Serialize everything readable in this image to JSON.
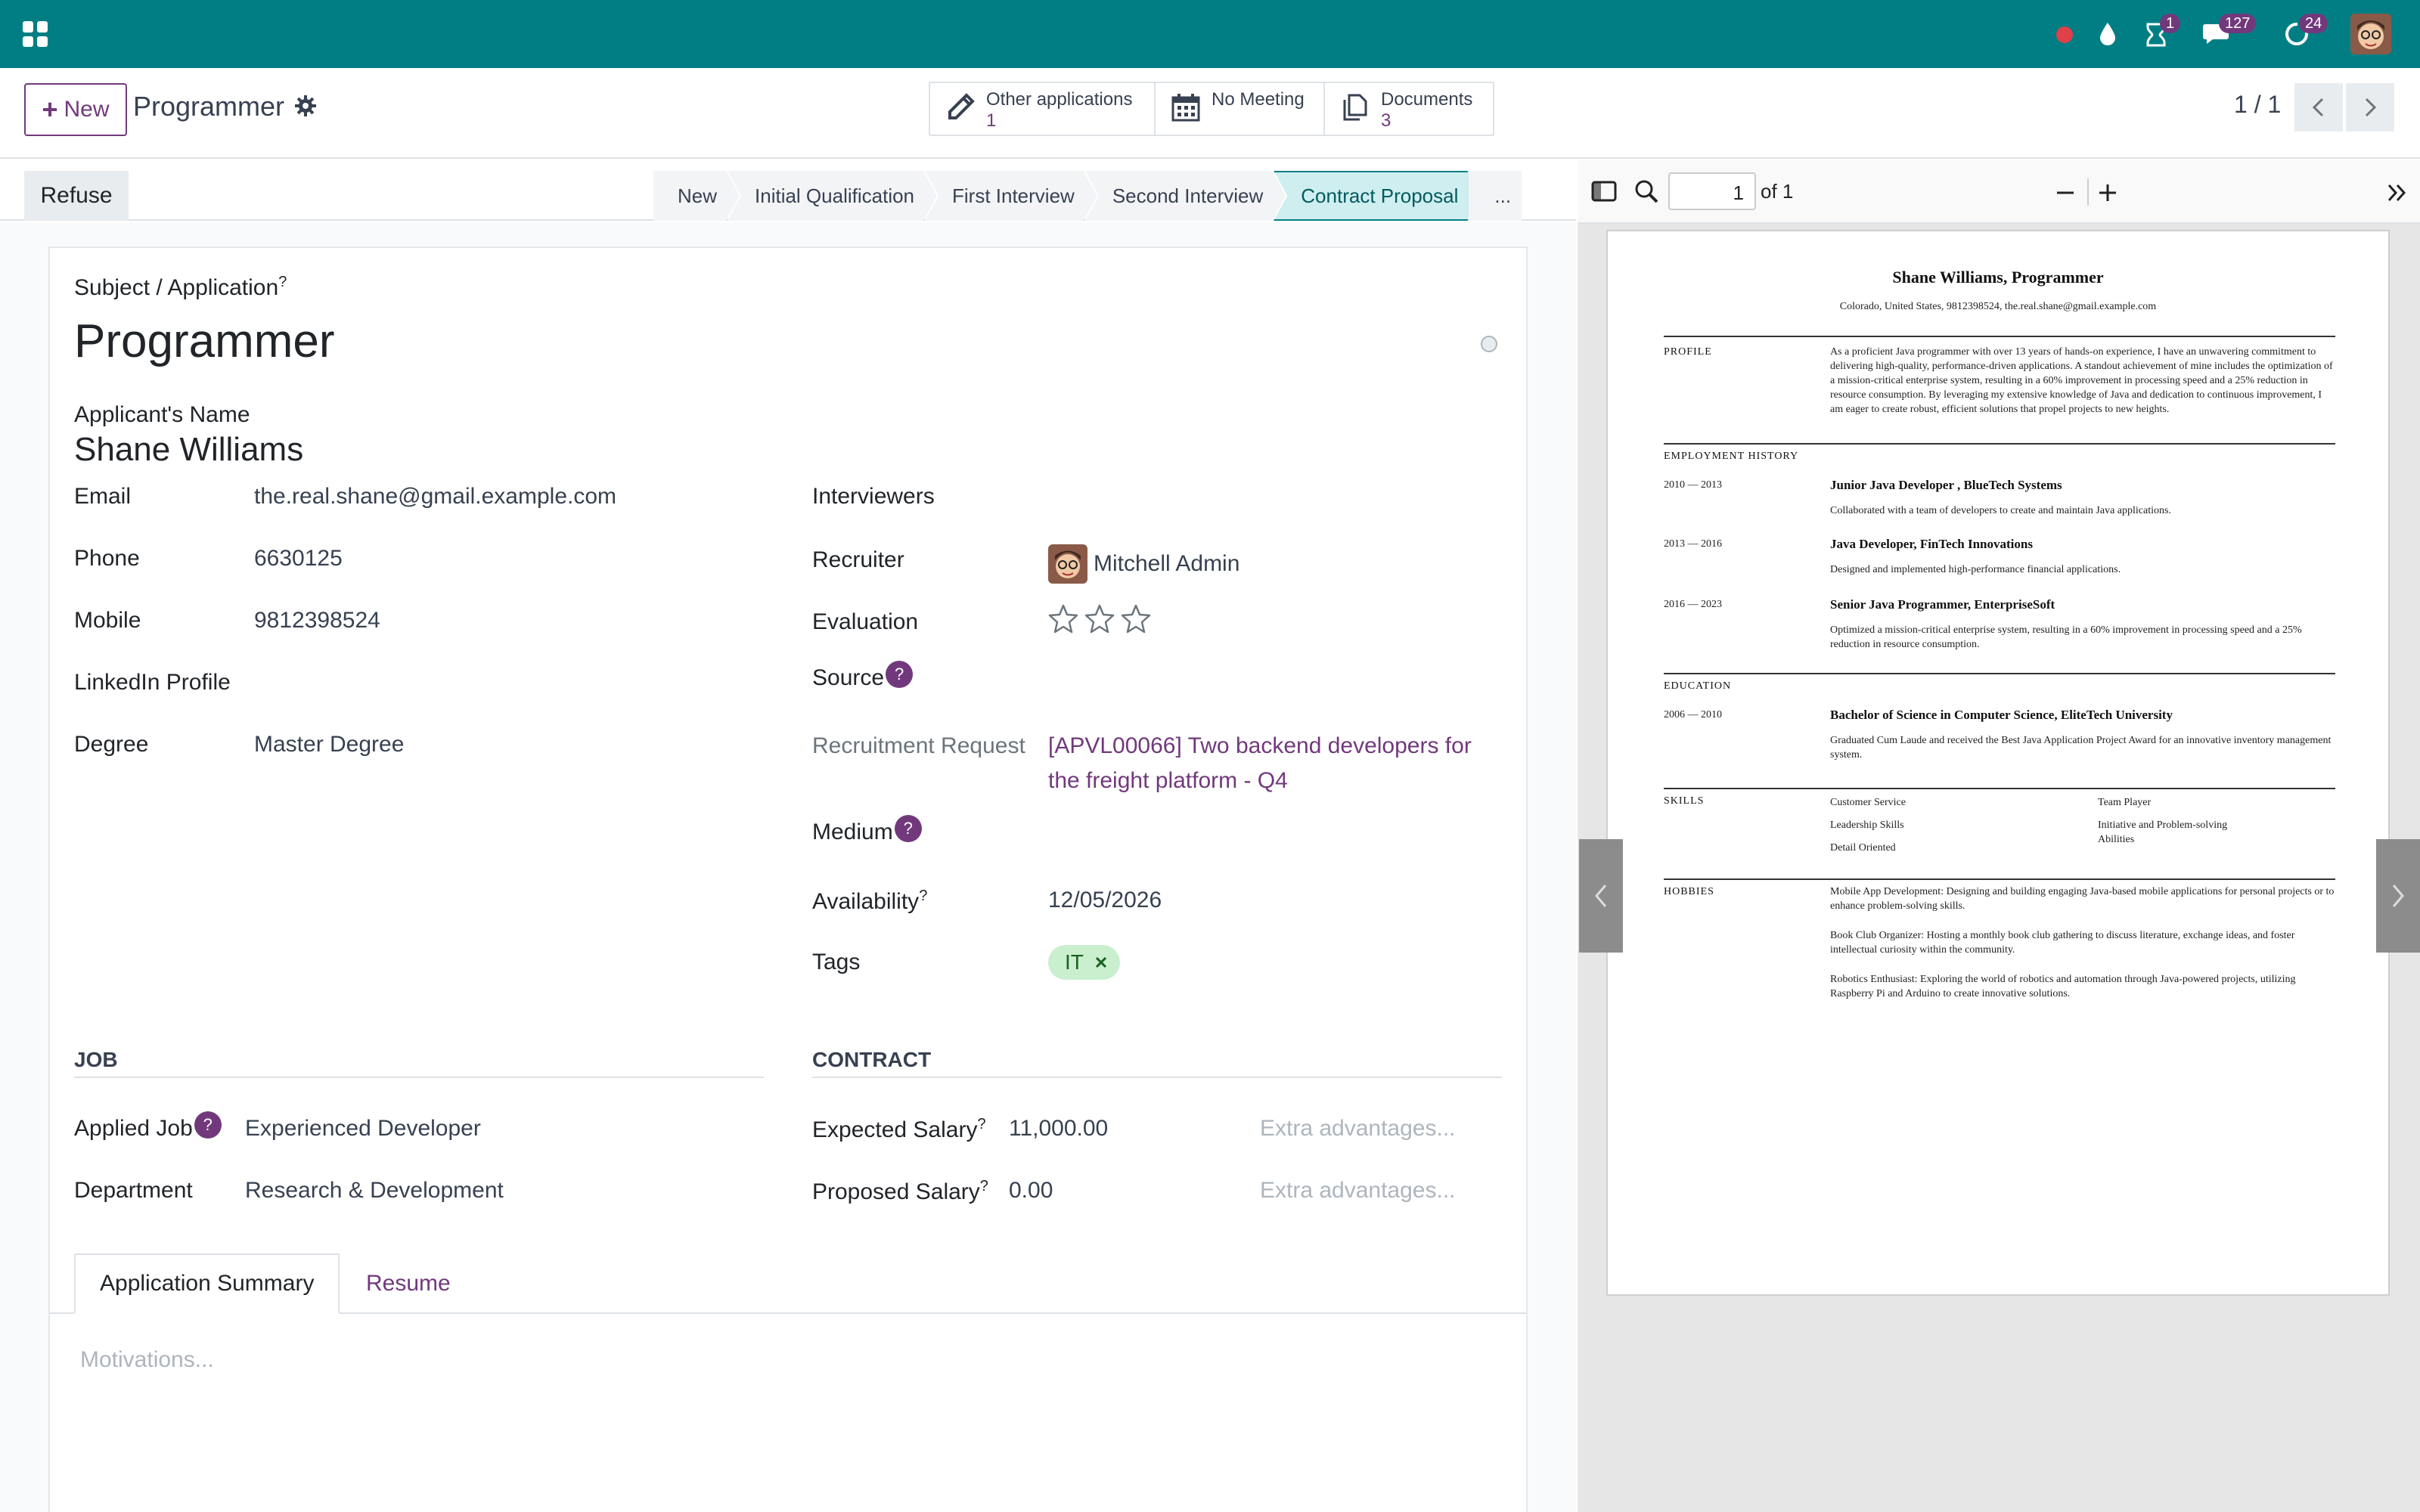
{
  "navbar": {
    "badges": {
      "activities": "1",
      "messages": "127",
      "updates": "24"
    }
  },
  "control": {
    "new_label": "New",
    "title": "Programmer",
    "smart_buttons": [
      {
        "label": "Other applications",
        "count": "1"
      },
      {
        "label": "No Meeting",
        "count": ""
      },
      {
        "label": "Documents",
        "count": "3"
      }
    ],
    "pager": "1 / 1"
  },
  "statusbar": {
    "refuse_label": "Refuse",
    "stages": [
      "New",
      "Initial Qualification",
      "First Interview",
      "Second Interview",
      "Contract Proposal",
      "..."
    ],
    "active_stage": "Contract Proposal"
  },
  "pdf_toolbar": {
    "page": "1",
    "of_label": "of 1"
  },
  "form": {
    "subject_label": "Subject / Application",
    "subject_sup": "?",
    "title": "Programmer",
    "applicant_label": "Applicant's Name",
    "applicant_name": "Shane Williams",
    "left_fields": [
      {
        "label": "Email",
        "value": "the.real.shane@gmail.example.com"
      },
      {
        "label": "Phone",
        "value": "6630125"
      },
      {
        "label": "Mobile",
        "value": "9812398524"
      },
      {
        "label": "LinkedIn Profile",
        "value": ""
      },
      {
        "label": "Degree",
        "value": "Master Degree"
      }
    ],
    "right_fields": {
      "interviewers_label": "Interviewers",
      "recruiter_label": "Recruiter",
      "recruiter_value": "Mitchell Admin",
      "evaluation_label": "Evaluation",
      "evaluation_stars": 0,
      "source_label": "Source",
      "recruitment_request_label": "Recruitment Request",
      "recruitment_request_value": "[APVL00066] Two backend developers for the freight platform - Q4",
      "medium_label": "Medium",
      "availability_label": "Availability",
      "availability_value": "12/05/2026",
      "tags_label": "Tags",
      "tag_value": "IT"
    },
    "job_section": {
      "heading": "JOB",
      "applied_job_label": "Applied Job",
      "applied_job_value": "Experienced Developer",
      "department_label": "Department",
      "department_value": "Research & Development"
    },
    "contract_section": {
      "heading": "CONTRACT",
      "expected_label": "Expected Salary",
      "expected_value": "11,000.00",
      "proposed_label": "Proposed Salary",
      "proposed_value": "0.00",
      "extra_placeholder": "Extra advantages..."
    },
    "tabs": [
      "Application Summary",
      "Resume"
    ],
    "motivations_placeholder": "Motivations..."
  },
  "resume": {
    "name": "Shane Williams, Programmer",
    "contact": "Colorado, United States, 9812398524, the.real.shane@gmail.example.com",
    "profile_heading": "PROFILE",
    "profile_text": "As a proficient Java programmer with over 13 years of hands-on experience, I have an unwavering commitment to delivering high-quality, performance-driven applications. A standout achievement of mine includes the optimization of a mission-critical enterprise system, resulting in a 60% improvement in processing speed and a 25% reduction in resource consumption. By leveraging my extensive knowledge of Java and dedication to continuous improvement, I am eager to create robust, efficient solutions that propel projects to new heights.",
    "employment_heading": "EMPLOYMENT HISTORY",
    "jobs": [
      {
        "dates": "2010 — 2013",
        "title": "Junior Java Developer , BlueTech Systems",
        "desc": "Collaborated with a team of developers to create and maintain Java applications."
      },
      {
        "dates": "2013 — 2016",
        "title": "Java Developer, FinTech Innovations",
        "desc": "Designed and implemented high-performance financial applications."
      },
      {
        "dates": "2016 — 2023",
        "title": "Senior Java Programmer, EnterpriseSoft",
        "desc": "Optimized a mission-critical enterprise system, resulting in a 60% improvement in processing speed and a 25% reduction in resource consumption."
      }
    ],
    "education_heading": "EDUCATION",
    "education": {
      "dates": "2006 — 2010",
      "title": "Bachelor of Science in Computer Science, EliteTech University",
      "desc": "Graduated Cum Laude and received the Best Java Application Project Award for an innovative inventory management system."
    },
    "skills_heading": "SKILLS",
    "skills": [
      "Customer Service",
      "Team Player",
      "Leadership Skills",
      "Initiative and Problem-solving Abilities",
      "Detail Oriented"
    ],
    "hobbies_heading": "HOBBIES",
    "hobbies": [
      "Mobile App Development: Designing and building engaging Java-based mobile applications for personal projects or to enhance problem-solving skills.",
      "Book Club Organizer: Hosting a monthly book club gathering to discuss literature, exchange ideas, and foster intellectual curiosity within the community.",
      "Robotics Enthusiast: Exploring the world of robotics and automation through Java-powered projects, utilizing Raspberry Pi and Arduino to create innovative solutions."
    ]
  }
}
